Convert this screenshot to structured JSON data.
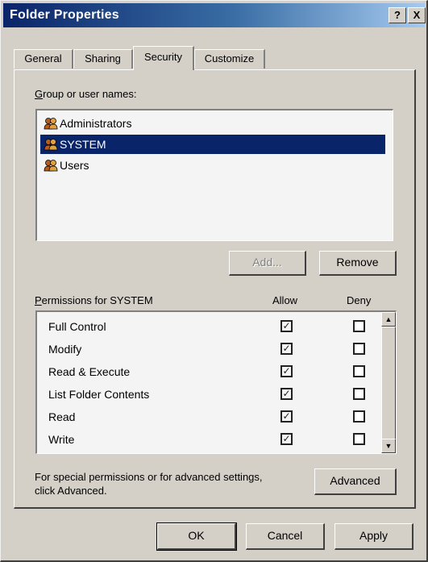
{
  "window": {
    "title": "Folder Properties",
    "help_label": "?",
    "close_label": "X"
  },
  "tabs": [
    {
      "label": "General",
      "active": false
    },
    {
      "label": "Sharing",
      "active": false
    },
    {
      "label": "Security",
      "active": true
    },
    {
      "label": "Customize",
      "active": false
    }
  ],
  "security": {
    "group_label": "Group or user names:",
    "users": [
      {
        "name": "Administrators",
        "icon": "user-group-icon",
        "selected": false
      },
      {
        "name": "SYSTEM",
        "icon": "user-group-icon",
        "selected": true
      },
      {
        "name": "Users",
        "icon": "user-group-icon",
        "selected": false
      }
    ],
    "add_label": "Add...",
    "remove_label": "Remove",
    "permissions_label": "Permissions for SYSTEM",
    "allow_label": "Allow",
    "deny_label": "Deny",
    "permissions": [
      {
        "name": "Full Control",
        "allow": true,
        "deny": false
      },
      {
        "name": "Modify",
        "allow": true,
        "deny": false
      },
      {
        "name": "Read & Execute",
        "allow": true,
        "deny": false
      },
      {
        "name": "List Folder Contents",
        "allow": true,
        "deny": false
      },
      {
        "name": "Read",
        "allow": true,
        "deny": false
      },
      {
        "name": "Write",
        "allow": true,
        "deny": false
      }
    ],
    "advanced_text_line1": "For special permissions or for advanced settings,",
    "advanced_text_line2": "click Advanced.",
    "advanced_label": "Advanced"
  },
  "footer": {
    "ok_label": "OK",
    "cancel_label": "Cancel",
    "apply_label": "Apply"
  },
  "colors": {
    "selection": "#0a246a",
    "face": "#d4d0c8"
  }
}
